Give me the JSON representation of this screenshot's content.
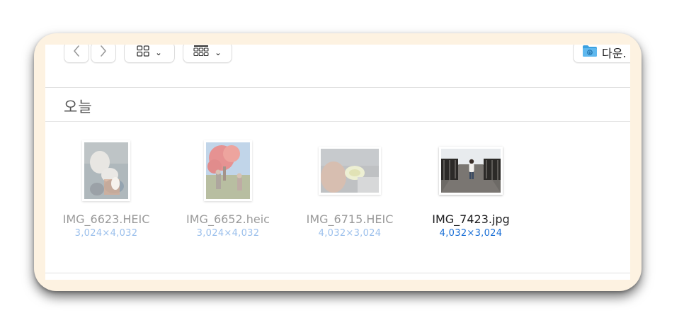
{
  "toolbar": {
    "back_icon": "chevron-left-icon",
    "forward_icon": "chevron-right-icon",
    "view_icons_icon": "grid-icon",
    "view_gallery_icon": "gallery-grid-icon",
    "location_label": "다운.",
    "location_icon": "folder-download-icon",
    "accent": "#3aa0e0"
  },
  "section": {
    "title": "오늘"
  },
  "files": [
    {
      "name": "IMG_6623.HEIC",
      "dims": "3,024×4,032",
      "selected": false
    },
    {
      "name": "IMG_6652.heic",
      "dims": "3,024×4,032",
      "selected": false
    },
    {
      "name": "IMG_6715.HEIC",
      "dims": "4,032×3,024",
      "selected": false
    },
    {
      "name": "IMG_7423.jpg",
      "dims": "4,032×3,024",
      "selected": true
    }
  ],
  "colors": {
    "frame": "#fdf2e1",
    "selected_dims": "#1a6fd6",
    "dim_text": "#9a9a9a"
  }
}
